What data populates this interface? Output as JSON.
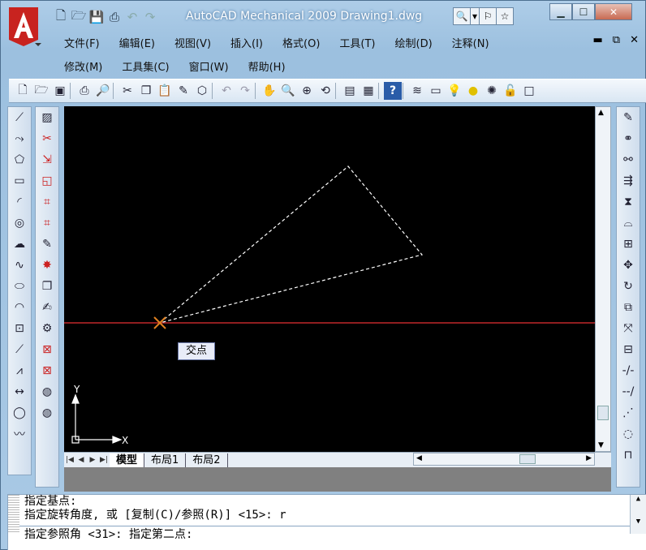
{
  "app": {
    "title": "AutoCAD Mechanical 2009   Drawing1.dwg"
  },
  "colors": {
    "canvas": "#000000",
    "crosshair": "#c0282a",
    "object": "#ffffff",
    "snap_marker": "#e08020"
  },
  "menu": {
    "row1": [
      "文件(F)",
      "编辑(E)",
      "视图(V)",
      "插入(I)",
      "格式(O)",
      "工具(T)",
      "绘制(D)",
      "注释(N)"
    ],
    "row2": [
      "修改(M)",
      "工具集(C)",
      "窗口(W)",
      "帮助(H)"
    ]
  },
  "icons": {
    "quick_access": [
      "new-icon",
      "open-icon",
      "save-icon",
      "print-icon",
      "undo-icon",
      "redo-icon"
    ]
  },
  "canvas": {
    "snap_tooltip": "交点",
    "ucs_x": "X",
    "ucs_y": "Y"
  },
  "layout_tabs": [
    "模型",
    "布局1",
    "布局2"
  ],
  "command": {
    "lines": [
      "指定基点:",
      "指定旋转角度, 或 [复制(C)/参照(R)] <15>:  r"
    ],
    "current": "指定参照角 <31>:  指定第二点:"
  }
}
